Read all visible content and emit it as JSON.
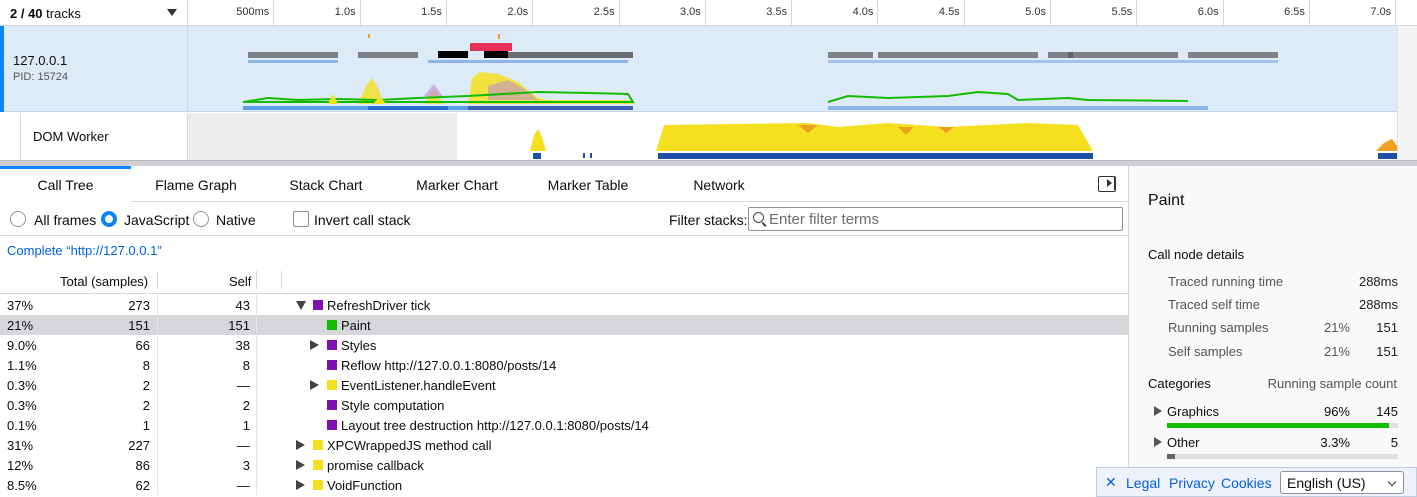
{
  "timeline": {
    "track_count": "2 / 40",
    "track_count_suffix": " tracks",
    "ticks": [
      "500ms",
      "1.0s",
      "1.5s",
      "2.0s",
      "2.5s",
      "3.0s",
      "3.5s",
      "4.0s",
      "4.5s",
      "5.0s",
      "5.5s",
      "6.0s",
      "6.5s",
      "7.0s"
    ],
    "process": {
      "name": "127.0.0.1",
      "pid": "PID: 15724"
    },
    "worker": {
      "name": "DOM Worker"
    }
  },
  "tabs": [
    "Call Tree",
    "Flame Graph",
    "Stack Chart",
    "Marker Chart",
    "Marker Table",
    "Network"
  ],
  "active_tab": "Call Tree",
  "settings": {
    "all_frames": "All frames",
    "javascript": "JavaScript",
    "native": "Native",
    "selected_mode": "JavaScript",
    "invert": "Invert call stack",
    "invert_checked": false,
    "filter_label": "Filter stacks:",
    "filter_placeholder": "Enter filter terms"
  },
  "breadcrumb": "Complete “http://127.0.0.1”",
  "tree": {
    "headers": {
      "total": "Total (samples)",
      "self": "Self"
    },
    "rows": [
      {
        "pct": "37%",
        "total": "273",
        "self": "43",
        "depth": 0,
        "twisty": "open",
        "color": "#7f0fb0",
        "name": "RefreshDriver tick",
        "selected": false
      },
      {
        "pct": "21%",
        "total": "151",
        "self": "151",
        "depth": 1,
        "twisty": "none",
        "color": "#12bc00",
        "name": "Paint",
        "selected": true
      },
      {
        "pct": "9.0%",
        "total": "66",
        "self": "38",
        "depth": 1,
        "twisty": "closed",
        "color": "#7f0fb0",
        "name": "Styles",
        "selected": false
      },
      {
        "pct": "1.1%",
        "total": "8",
        "self": "8",
        "depth": 1,
        "twisty": "none",
        "color": "#7f0fb0",
        "name": "Reflow http://127.0.0.1:8080/posts/14",
        "selected": false
      },
      {
        "pct": "0.3%",
        "total": "2",
        "self": "—",
        "depth": 1,
        "twisty": "closed",
        "color": "#f5e020",
        "name": "EventListener.handleEvent",
        "selected": false
      },
      {
        "pct": "0.3%",
        "total": "2",
        "self": "2",
        "depth": 1,
        "twisty": "none",
        "color": "#7f0fb0",
        "name": "Style computation",
        "selected": false
      },
      {
        "pct": "0.1%",
        "total": "1",
        "self": "1",
        "depth": 1,
        "twisty": "none",
        "color": "#7f0fb0",
        "name": "Layout tree destruction http://127.0.0.1:8080/posts/14",
        "selected": false
      },
      {
        "pct": "31%",
        "total": "227",
        "self": "—",
        "depth": 0,
        "twisty": "closed",
        "color": "#f5e020",
        "name": "XPCWrappedJS method call",
        "selected": false
      },
      {
        "pct": "12%",
        "total": "86",
        "self": "3",
        "depth": 0,
        "twisty": "closed",
        "color": "#f5e020",
        "name": "promise callback",
        "selected": false
      },
      {
        "pct": "8.5%",
        "total": "62",
        "self": "—",
        "depth": 0,
        "twisty": "closed",
        "color": "#f5e020",
        "name": "VoidFunction",
        "selected": false
      }
    ]
  },
  "sidebar": {
    "title": "Paint",
    "section": "Call node details",
    "details": [
      {
        "label": "Traced running time",
        "value": "288ms"
      },
      {
        "label": "Traced self time",
        "value": "288ms"
      },
      {
        "label": "Running samples",
        "pct": "21%",
        "value": "151"
      },
      {
        "label": "Self samples",
        "pct": "21%",
        "value": "151"
      }
    ],
    "categories_title": "Categories",
    "categories_count_label": "Running sample count",
    "categories": [
      {
        "name": "Graphics",
        "pct": "96%",
        "count": "145",
        "fraction": 0.96,
        "color": "#12bc00"
      },
      {
        "name": "Other",
        "pct": "3.3%",
        "count": "5",
        "fraction": 0.033,
        "color": "#666666"
      }
    ]
  },
  "footer": {
    "close": "✕",
    "legal": "Legal",
    "privacy": "Privacy",
    "cookies": "Cookies",
    "language": "English (US)"
  },
  "colors": {
    "accent": "#0a84ff",
    "link": "#0060df",
    "js": "#f5e020",
    "layout": "#7f0fb0",
    "graphics": "#12bc00"
  }
}
